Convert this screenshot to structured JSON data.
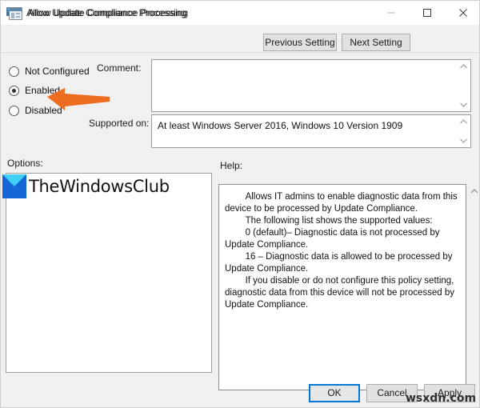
{
  "window": {
    "title": "Allow Update Compliance Processing",
    "title_icon": "monitor-icon",
    "controls": {
      "minimize": "minimize-icon",
      "maximize": "maximize-icon",
      "close": "close-icon"
    }
  },
  "header": {
    "policy_icon": "policy-setting-icon",
    "policy_title": "Allow Update Compliance Processing",
    "previous_setting": "Previous Setting",
    "next_setting": "Next Setting"
  },
  "state": {
    "options": [
      {
        "label": "Not Configured",
        "selected": false
      },
      {
        "label": "Enabled",
        "selected": true
      },
      {
        "label": "Disabled",
        "selected": false
      }
    ]
  },
  "comment": {
    "label": "Comment:",
    "value": "",
    "scroll_up_icon": "chevron-up-icon",
    "scroll_down_icon": "chevron-down-icon"
  },
  "supported": {
    "label": "Supported on:",
    "value": "At least Windows Server 2016, Windows 10 Version 1909",
    "scroll_up_icon": "chevron-up-icon",
    "scroll_down_icon": "chevron-down-icon"
  },
  "options_pane": {
    "label": "Options:",
    "content": ""
  },
  "help_pane": {
    "label": "Help:",
    "scroll_up_icon": "chevron-up-icon",
    "text": "        Allows IT admins to enable diagnostic data from this device to be processed by Update Compliance.\n        The following list shows the supported values:\n        0 (default)– Diagnostic data is not processed by Update Compliance.\n        16 – Diagnostic data is allowed to be processed by Update Compliance.\n        If you disable or do not configure this policy setting, diagnostic data from this device will not be processed by Update Compliance."
  },
  "buttons": {
    "ok": "OK",
    "cancel": "Cancel",
    "apply": "Apply"
  },
  "annotations": {
    "arrow_color": "#ED6C20",
    "arrow_target": "Enabled"
  },
  "watermarks": {
    "brand_text": "TheWindowsClub",
    "brand_logo_colors": {
      "light": "#22C1F0",
      "dark": "#1565D8"
    },
    "site_text": "wsxdn.com"
  }
}
